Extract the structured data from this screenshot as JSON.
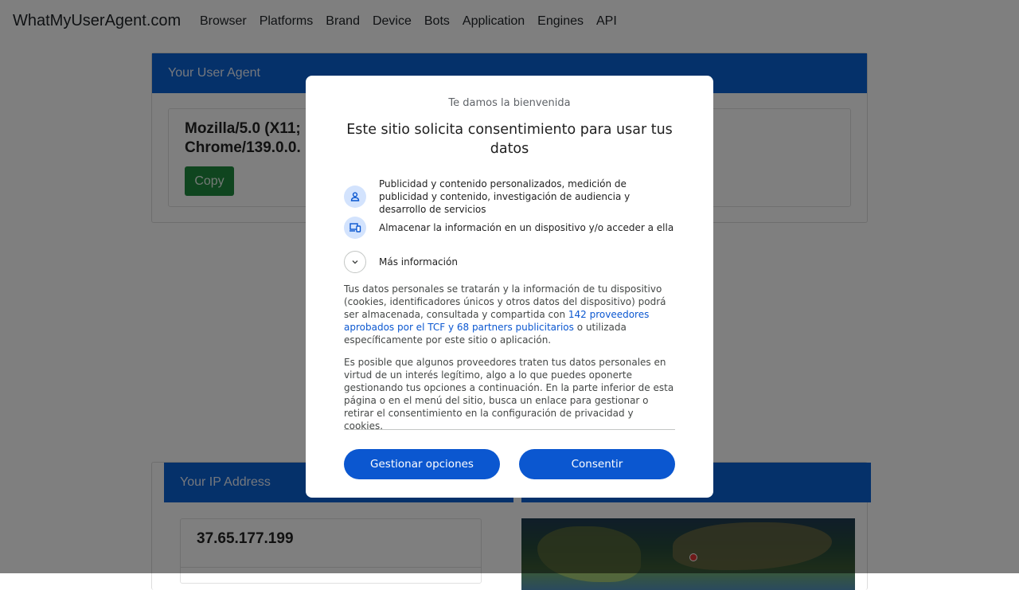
{
  "nav": {
    "brand": "WhatMyUserAgent.com",
    "links": [
      "Browser",
      "Platforms",
      "Brand",
      "Device",
      "Bots",
      "Application",
      "Engines",
      "API"
    ]
  },
  "ua_card": {
    "title": "Your User Agent",
    "ua_line1": "Mozilla/5.0 (X11;",
    "ua_line2": "Chrome/139.0.0.",
    "copy_label": "Copy"
  },
  "ip_card": {
    "title": "Your IP Address",
    "ip": "37.65.177.199"
  },
  "consent": {
    "welcome": "Te damos la bienvenida",
    "headline": "Este sitio solicita consentimiento para usar tus datos",
    "purpose1": "Publicidad y contenido personalizados, medición de publicidad y contenido, investigación de audiencia y desarrollo de servicios",
    "purpose1_icon": "person-icon",
    "purpose2": "Almacenar la información en un dispositivo y/o acceder a ella",
    "purpose2_icon": "devices-icon",
    "more_info": "Más información",
    "para1_a": "Tus datos personales se tratarán y la información de tu dispositivo (cookies, identificadores únicos y otros datos del dispositivo) podrá ser almacenada, consultada y compartida con ",
    "para1_link": "142 proveedores aprobados por el TCF y 68 partners publicitarios",
    "para1_b": " o utilizada específicamente por este sitio o aplicación.",
    "para2": "Es posible que algunos proveedores traten tus datos personales en virtud de un interés legítimo, algo a lo que puedes oponerte gestionando tus opciones a continuación. En la parte inferior de esta página o en el menú del sitio, busca un enlace para gestionar o retirar el consentimiento en la configuración de privacidad y cookies.",
    "manage_label": "Gestionar opciones",
    "consent_label": "Consentir",
    "accent": "#0b57d0"
  }
}
